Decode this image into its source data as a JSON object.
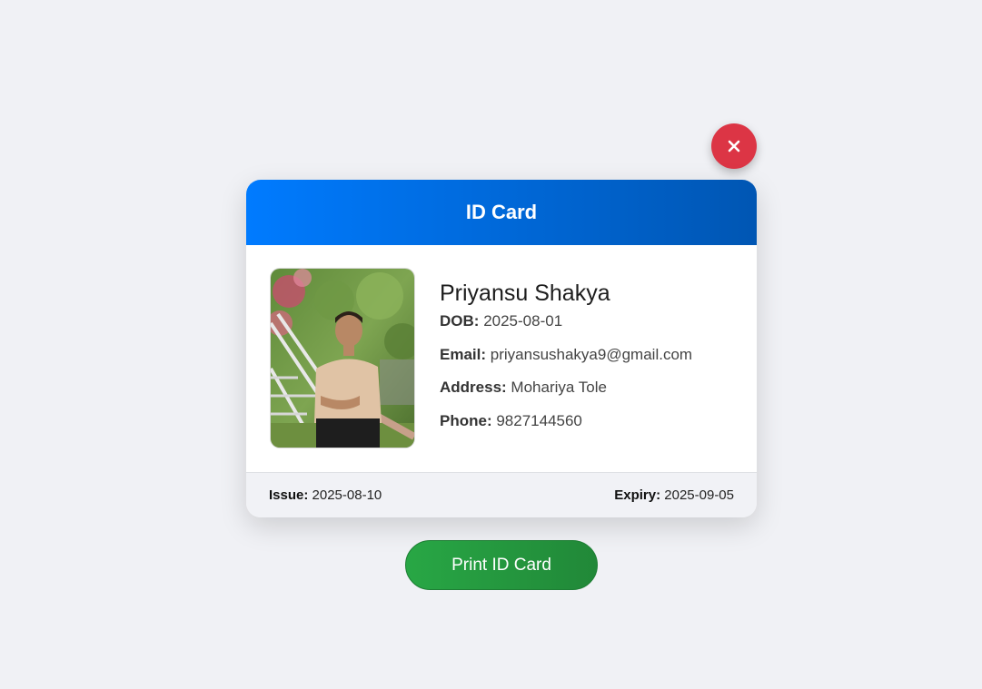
{
  "close": {
    "icon": "close-icon",
    "color": "#dc3545"
  },
  "card": {
    "title": "ID Card",
    "header_gradient": [
      "#007bff",
      "#0056b3"
    ],
    "photo": {
      "alt": "profile-photo"
    },
    "name": "Priyansu Shakya",
    "fields": [
      {
        "label": "DOB:",
        "value": "2025-08-01"
      },
      {
        "label": "Email:",
        "value": "priyansushakya9@gmail.com"
      },
      {
        "label": "Address:",
        "value": "Mohariya Tole"
      },
      {
        "label": "Phone:",
        "value": "9827144560"
      }
    ],
    "footer": {
      "issue_label": "Issue:",
      "issue_value": "2025-08-10",
      "expiry_label": "Expiry:",
      "expiry_value": "2025-09-05"
    }
  },
  "print_button": {
    "label": "Print ID Card",
    "color": "#28a745"
  }
}
